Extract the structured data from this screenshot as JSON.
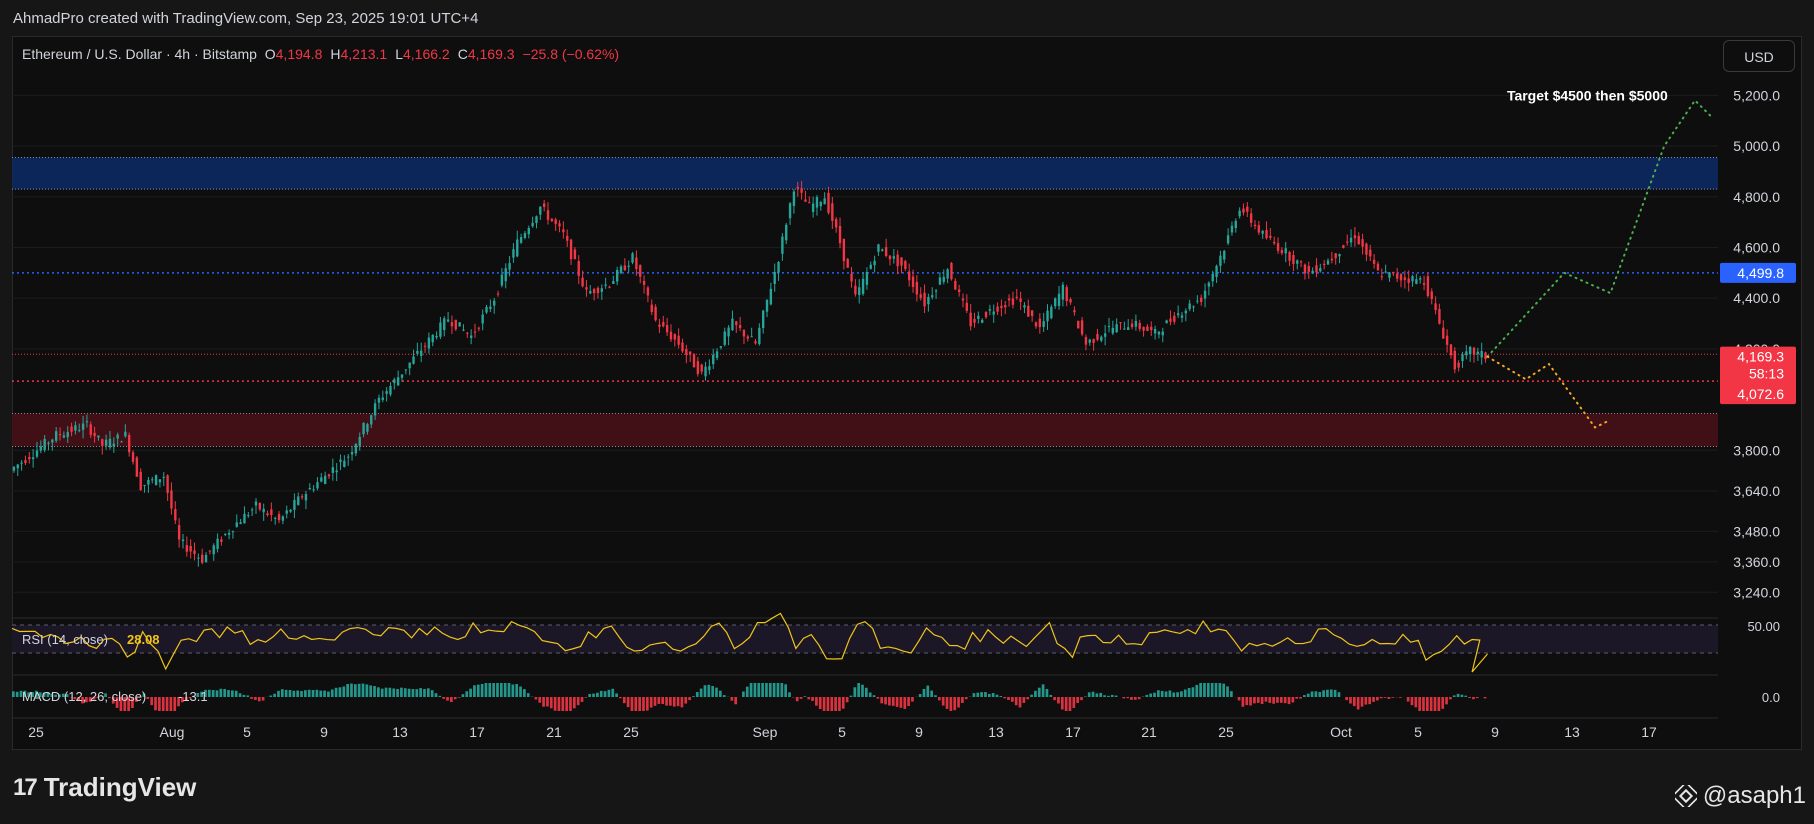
{
  "credit": "AhmadPro created with TradingView.com, Sep 23, 2025 19:01 UTC+4",
  "legend": {
    "symbol": "Ethereum / U.S. Dollar · 4h · Bitstamp",
    "o_label": "O",
    "o": "4,194.8",
    "h_label": "H",
    "h": "4,213.1",
    "l_label": "L",
    "l": "4,166.2",
    "c_label": "C",
    "c": "4,169.3",
    "change": "−25.8 (−0.62%)"
  },
  "currency": "USD",
  "annotation": "Target $4500 then $5000",
  "price_badges": {
    "resistance": "4,499.8",
    "last": "4,169.3",
    "countdown": "58:13",
    "support": "4,072.6"
  },
  "rsi": {
    "label": "RSI (14, close)",
    "value": "28.08",
    "axis": "50.00"
  },
  "macd": {
    "label": "MACD (12, 26, close)",
    "value": "-13.1",
    "axis": "0.0"
  },
  "brand": {
    "logo": "17",
    "name": "TradingView"
  },
  "handle": "@asaph1",
  "colors": {
    "up": "#26a69a",
    "down": "#f23645",
    "blue_zone": "#0d2a66",
    "red_zone": "#4a1119",
    "rsi": "#f0c419",
    "proj_up": "#4caf50",
    "proj_down": "#f5a623"
  },
  "chart_data": {
    "type": "candlestick",
    "interval": "4h",
    "y_ticks": [
      5200,
      5000,
      4800,
      4600,
      4400,
      4200,
      3800,
      3640,
      3480,
      3360,
      3240
    ],
    "y_tick_labels": [
      "5,200.0",
      "5,000.0",
      "4,800.0",
      "4,600.0",
      "4,400.0",
      "4,200.0",
      "3,800.0",
      "3,640.0",
      "3,480.0",
      "3,360.0",
      "3,240.0"
    ],
    "x_tick_labels": [
      "25",
      "Aug",
      "5",
      "9",
      "13",
      "17",
      "21",
      "25",
      "Sep",
      "5",
      "9",
      "13",
      "17",
      "21",
      "25",
      "Oct",
      "5",
      "9",
      "13",
      "17"
    ],
    "zones": [
      {
        "name": "resistance-zone",
        "from": 4830,
        "to": 4955,
        "color": "blue"
      },
      {
        "name": "support-zone",
        "from": 3815,
        "to": 3945,
        "color": "red"
      }
    ],
    "horizontal_levels": [
      4499.8,
      4179,
      4072.6
    ],
    "price_path": [
      [
        0,
        3720
      ],
      [
        6,
        3860
      ],
      [
        10,
        3900
      ],
      [
        12,
        3820
      ],
      [
        15,
        3860
      ],
      [
        17,
        3660
      ],
      [
        20,
        3700
      ],
      [
        22,
        3440
      ],
      [
        25,
        3370
      ],
      [
        29,
        3500
      ],
      [
        32,
        3580
      ],
      [
        35,
        3520
      ],
      [
        38,
        3620
      ],
      [
        44,
        3780
      ],
      [
        48,
        4000
      ],
      [
        53,
        4180
      ],
      [
        57,
        4320
      ],
      [
        60,
        4250
      ],
      [
        63,
        4400
      ],
      [
        66,
        4620
      ],
      [
        69,
        4760
      ],
      [
        72,
        4650
      ],
      [
        75,
        4420
      ],
      [
        78,
        4460
      ],
      [
        81,
        4560
      ],
      [
        84,
        4310
      ],
      [
        87,
        4220
      ],
      [
        90,
        4100
      ],
      [
        94,
        4300
      ],
      [
        97,
        4220
      ],
      [
        100,
        4560
      ],
      [
        102,
        4840
      ],
      [
        104,
        4760
      ],
      [
        106,
        4800
      ],
      [
        108,
        4620
      ],
      [
        110,
        4400
      ],
      [
        113,
        4600
      ],
      [
        116,
        4530
      ],
      [
        119,
        4380
      ],
      [
        122,
        4520
      ],
      [
        125,
        4300
      ],
      [
        128,
        4360
      ],
      [
        131,
        4400
      ],
      [
        134,
        4280
      ],
      [
        137,
        4440
      ],
      [
        140,
        4220
      ],
      [
        143,
        4280
      ],
      [
        146,
        4300
      ],
      [
        149,
        4260
      ],
      [
        152,
        4340
      ],
      [
        155,
        4400
      ],
      [
        158,
        4600
      ],
      [
        160,
        4760
      ],
      [
        163,
        4650
      ],
      [
        166,
        4580
      ],
      [
        169,
        4500
      ],
      [
        172,
        4560
      ],
      [
        175,
        4650
      ],
      [
        178,
        4500
      ],
      [
        181,
        4480
      ],
      [
        184,
        4470
      ],
      [
        186,
        4300
      ],
      [
        188,
        4130
      ],
      [
        190,
        4190
      ],
      [
        192,
        4169.3
      ]
    ],
    "projection_up": [
      [
        192,
        4169.3
      ],
      [
        202,
        4500
      ],
      [
        208,
        4420
      ],
      [
        215,
        5000
      ],
      [
        219,
        5180
      ],
      [
        221,
        5120
      ]
    ],
    "projection_down": [
      [
        192,
        4169.3
      ],
      [
        197,
        4080
      ],
      [
        200,
        4140
      ],
      [
        206,
        3890
      ],
      [
        208,
        3920
      ]
    ],
    "rsi_level": 28.08,
    "macd_level": -13.1
  }
}
